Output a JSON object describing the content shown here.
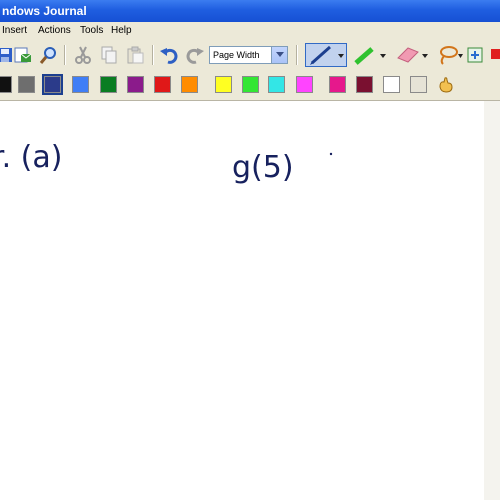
{
  "window": {
    "title": "ndows Journal"
  },
  "menu": {
    "items": [
      "Insert",
      "Actions",
      "Tools",
      "Help"
    ]
  },
  "toolbar": {
    "zoom_value": "Page Width"
  },
  "palette": {
    "colors": [
      "#111111",
      "#6e6e6e",
      "#2b3b8a",
      "#3f7ef6",
      "#0a7d22",
      "#8b1b8b",
      "#e01818",
      "#ff8c00",
      "#ffff22",
      "#33e633",
      "#33e6e6",
      "#ff44ff",
      "#e6188c",
      "#7a1030",
      "#ffffff",
      "#e6e3d6"
    ],
    "selected_index": 2
  },
  "ink": {
    "left_text": "r. (a)",
    "right_text": "g(5)"
  }
}
